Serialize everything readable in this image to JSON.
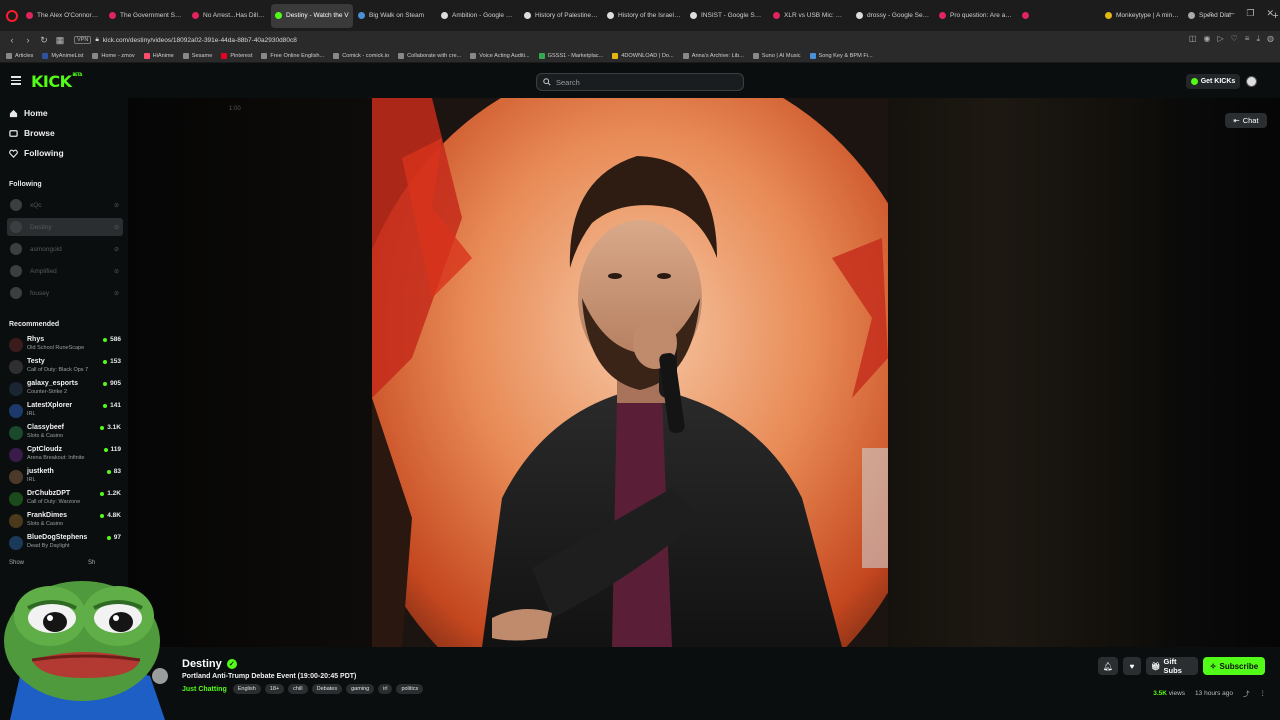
{
  "browser": {
    "tabs": [
      {
        "label": "The Alex O'Connor Pod",
        "color": "#e0245e"
      },
      {
        "label": "The Government Shutdo",
        "color": "#e0245e"
      },
      {
        "label": "No Arrest...Has Dilled Be",
        "color": "#e0245e"
      },
      {
        "label": "Destiny - Watch the V",
        "color": "#53fc18",
        "active": true
      },
      {
        "label": "Big Walk on Steam",
        "color": "#4a90d9"
      },
      {
        "label": "Ambition - Google Sear",
        "color": "#dddddd"
      },
      {
        "label": "History of Palestine - Wi",
        "color": "#dddddd"
      },
      {
        "label": "History of the Israeli-Pa",
        "color": "#dddddd"
      },
      {
        "label": "INSIST - Google Search",
        "color": "#dddddd"
      },
      {
        "label": "XLR vs USB Mic: Which S",
        "color": "#e0245e"
      },
      {
        "label": "drossy - Google Search",
        "color": "#dddddd"
      },
      {
        "label": "Pro question: Are all mi",
        "color": "#e0245e"
      },
      {
        "label": "",
        "color": "#e0245e"
      },
      {
        "label": "Monkeytype | A minimal",
        "color": "#e2b714"
      },
      {
        "label": "Speed Dial",
        "color": "#aaaaaa"
      }
    ],
    "url": "kick.com/destiny/videos/18092a02-391e-44da-88b7-40a2930d80c8",
    "vpn": "VPN",
    "bookmarks": [
      {
        "label": "Articles",
        "color": "#888888"
      },
      {
        "label": "MyAnimeList",
        "color": "#2e51a2"
      },
      {
        "label": "Home - zmov",
        "color": "#888888"
      },
      {
        "label": "HiAnime",
        "color": "#ff4d6d"
      },
      {
        "label": "Sesame",
        "color": "#888888"
      },
      {
        "label": "Pinterest",
        "color": "#e60023"
      },
      {
        "label": "Free Online English...",
        "color": "#888888"
      },
      {
        "label": "Comick - comick.io",
        "color": "#888888"
      },
      {
        "label": "Collaborate with cre...",
        "color": "#888888"
      },
      {
        "label": "Voice Acting Auditi...",
        "color": "#888888"
      },
      {
        "label": "GSSS1 - Marketplac...",
        "color": "#34a853"
      },
      {
        "label": "4DOWNLOAD | Do...",
        "color": "#e2b714"
      },
      {
        "label": "Anna's Archive: Lib...",
        "color": "#888888"
      },
      {
        "label": "Suno | AI Music",
        "color": "#888888"
      },
      {
        "label": "Song Key & BPM Fi...",
        "color": "#4a90d9"
      }
    ]
  },
  "header": {
    "logo": "KICK",
    "logo_badge": "BETA",
    "search_placeholder": "Search",
    "get_kicks": "Get KICKs"
  },
  "sidebar": {
    "nav": [
      {
        "label": "Home",
        "icon": "home-icon"
      },
      {
        "label": "Browse",
        "icon": "browse-icon"
      },
      {
        "label": "Following",
        "icon": "heart-icon"
      }
    ],
    "following_title": "Following",
    "following": [
      {
        "name": "xQc"
      },
      {
        "name": "Destiny"
      },
      {
        "name": "asmongold"
      },
      {
        "name": "Amplified"
      },
      {
        "name": "fousey"
      }
    ],
    "recommended_title": "Recommended",
    "recommended": [
      {
        "name": "Rhys",
        "category": "Old School RuneScape",
        "viewers": "586",
        "color": "#3b1b1b"
      },
      {
        "name": "Testy",
        "category": "Call of Duty: Black Ops 7",
        "viewers": "153",
        "color": "#2f2f2f"
      },
      {
        "name": "galaxy_esports",
        "category": "Counter-Strike 2",
        "viewers": "905",
        "color": "#1b2433"
      },
      {
        "name": "LatestXplorer",
        "category": "IRL",
        "viewers": "141",
        "color": "#1b3a6b"
      },
      {
        "name": "Classybeef",
        "category": "Slots & Casino",
        "viewers": "3.1K",
        "color": "#1b4a2b"
      },
      {
        "name": "CptCloudz",
        "category": "Arena Breakout: Infinite",
        "viewers": "119",
        "color": "#3a1b4a"
      },
      {
        "name": "justketh",
        "category": "IRL",
        "viewers": "83",
        "color": "#4a3a2b"
      },
      {
        "name": "DrChubzDPT",
        "category": "Call of Duty: Warzone",
        "viewers": "1.2K",
        "color": "#1b4a1b"
      },
      {
        "name": "FrankDimes",
        "category": "Slots & Casino",
        "viewers": "4.8K",
        "color": "#4a3a1b"
      },
      {
        "name": "BlueDogStephens",
        "category": "Dead By Daylight",
        "viewers": "97",
        "color": "#1b3a5a"
      }
    ],
    "show_more": "Show",
    "show_less": "Sh"
  },
  "video": {
    "timestamp": "1:00",
    "chat_label": "Chat"
  },
  "stream": {
    "streamer": "Destiny",
    "title": "Portland Anti-Trump Debate Event (19:00-20:45 PDT)",
    "category": "Just Chatting",
    "tags": [
      "English",
      "18+",
      "chill",
      "Debates",
      "gaming",
      "irl",
      "politics"
    ],
    "gift_subs": "Gift Subs",
    "subscribe": "Subscribe",
    "views": "3.5K",
    "views_label": "views",
    "time_ago": "13 hours ago"
  },
  "colors": {
    "accent": "#53fc18",
    "bg": "#0b0e0f"
  }
}
